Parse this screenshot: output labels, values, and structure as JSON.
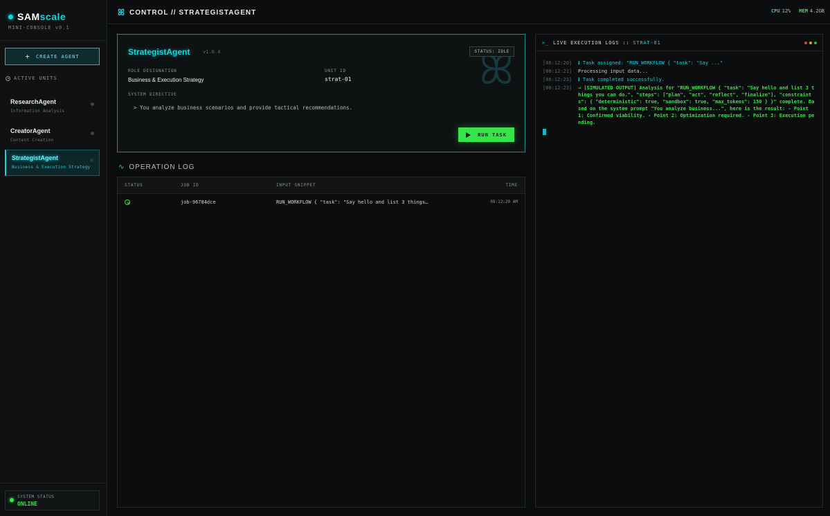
{
  "sidebar": {
    "brand_a": "SAM",
    "brand_b": "scale",
    "subtitle": "MINI-CONSOLE v0.1",
    "create_label": "CREATE AGENT",
    "active_units_label": "ACTIVE UNITS",
    "agents": [
      {
        "name": "ResearchAgent",
        "desc": "Information Analysis"
      },
      {
        "name": "CreatorAgent",
        "desc": "Content Creation"
      },
      {
        "name": "StrategistAgent",
        "desc": "Business & Execution Strategy"
      }
    ],
    "system_status_label": "SYSTEM STATUS",
    "system_status_value": "ONLINE"
  },
  "header": {
    "breadcrumb": "CONTROL // STRATEGISTAGENT",
    "cpu_label": "CPU",
    "cpu_value": "12%",
    "mem_label": "MEM",
    "mem_value": "4.2GB"
  },
  "agent_card": {
    "name": "StrategistAgent",
    "version": "v1.0.4",
    "status": "STATUS: IDLE",
    "role_label": "ROLE DESIGNATION",
    "role_value": "Business & Execution Strategy",
    "unit_label": "UNIT ID",
    "unit_value": "strat-01",
    "directive_label": "SYSTEM DIRECTIVE",
    "directive_value": "> You analyze business scenarios and provide tactical recommendations.",
    "run_label": "RUN TASK"
  },
  "operation_log": {
    "title": "OPERATION LOG",
    "columns": [
      "STATUS",
      "JOB ID",
      "INPUT SNIPPET",
      "TIME"
    ],
    "rows": [
      {
        "job_id": "job-96784dce",
        "input": "RUN_WORKFLOW { \"task\": \"Say hello and list 3 things…",
        "time": "08:12:20 AM"
      }
    ]
  },
  "live_logs": {
    "title": "LIVE EXECUTION LOGS ::",
    "unit": "STRAT-01",
    "lines": [
      {
        "ts": "[08:12:20]",
        "msg": "ℹ Task assigned: \"RUN_WORKFLOW { \"task\": \"Say ...\""
      },
      {
        "ts": "[08:12:21]",
        "msg": "Processing input data..."
      },
      {
        "ts": "[08:12:23]",
        "msg": "ℹ Task completed successfully."
      },
      {
        "ts": "[08:12:23]",
        "msg": "→ [SIMULATED OUTPUT] Analysis for \"RUN_WORKFLOW { \"task\": \"Say hello and list 3 things you can do.\", \"steps\": [\"plan\", \"act\", \"reflect\", \"finalize\"], \"constraints\": { \"deterministic\": true, \"sandbox\": true, \"max_tokens\": 150 } }\" complete. Based on the system prompt \"You analyze business...\", here is the result: - Point 1: Confirmed viability. - Point 2: Optimization required. - Point 3: Execution pending."
      }
    ]
  },
  "colors": {
    "accent_cyan": "#19d3de",
    "accent_green": "#37e34a",
    "background": "#0b0c0d"
  }
}
